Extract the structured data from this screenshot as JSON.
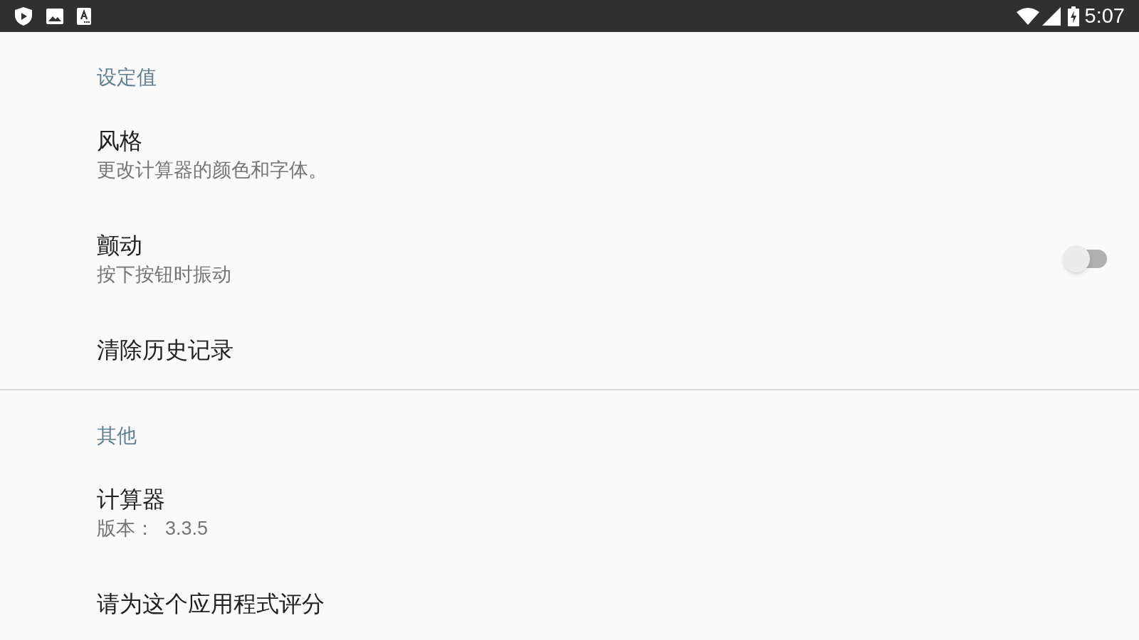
{
  "status_bar": {
    "time": "5:07"
  },
  "sections": [
    {
      "header": "设定值",
      "items": [
        {
          "kind": "plain",
          "title": "风格",
          "subtitle": "更改计算器的颜色和字体。"
        },
        {
          "kind": "toggle",
          "title": "颤动",
          "subtitle": "按下按钮时振动",
          "on": false
        },
        {
          "kind": "plain",
          "title": "清除历史记录"
        }
      ]
    },
    {
      "header": "其他",
      "items": [
        {
          "kind": "plain",
          "title": "计算器",
          "subtitle": "版本：  3.3.5"
        },
        {
          "kind": "plain",
          "title": "请为这个应用程式评分"
        }
      ]
    }
  ]
}
